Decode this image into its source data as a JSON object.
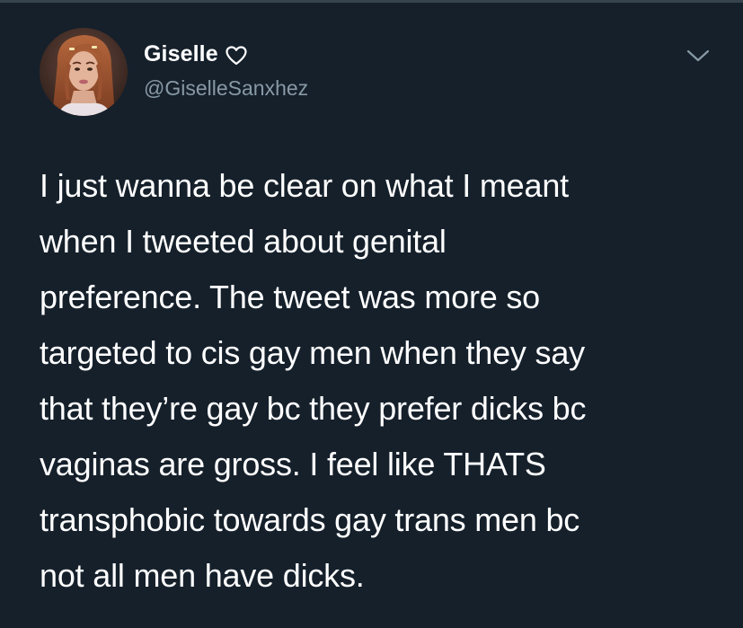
{
  "author": {
    "display_name": "Giselle",
    "handle": "@GiselleSanxhez",
    "name_icon": "heart-outline-icon",
    "avatar_icon": "profile-photo-avatar"
  },
  "menu_icon": "chevron-down-icon",
  "tweet": {
    "lines": [
      "I just wanna be clear on what I meant",
      "when I tweeted about genital",
      "preference. The tweet was more so",
      "targeted to cis gay men when they say",
      "that they’re gay bc they prefer dicks bc",
      "vaginas are gross. I feel like THATS",
      "transphobic towards gay trans men bc",
      "not all men have dicks."
    ]
  },
  "colors": {
    "background": "#15202b",
    "text": "#ffffff",
    "secondary_text": "#8899a6",
    "divider": "#38444d"
  }
}
